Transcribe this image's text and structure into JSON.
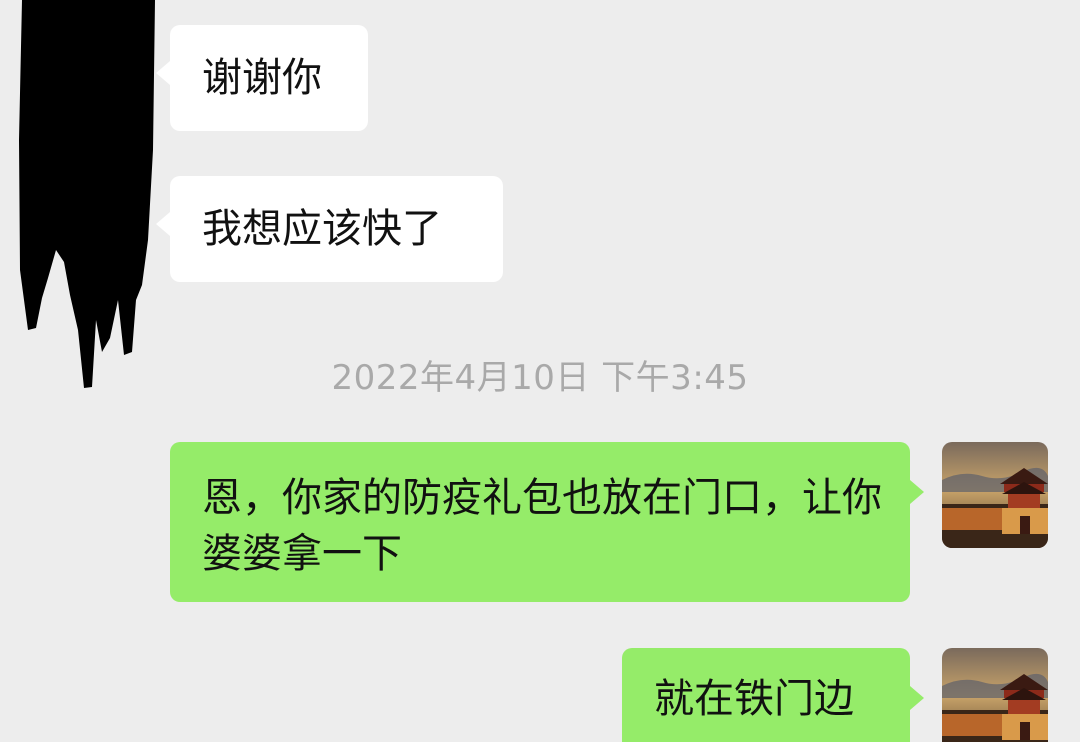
{
  "messages": [
    {
      "side": "left",
      "text": "谢谢你"
    },
    {
      "side": "left",
      "text": "我想应该快了"
    },
    {
      "side": "right",
      "text": "恩，你家的防疫礼包也放在门口，让你婆婆拿一下"
    },
    {
      "side": "right",
      "text": "就在铁门边"
    }
  ],
  "timestamp": "2022年4月10日 下午3:45",
  "colors": {
    "background": "#ededed",
    "incoming_bubble": "#ffffff",
    "outgoing_bubble": "#95ec69",
    "timestamp_text": "#a9a9a9"
  },
  "avatar": {
    "icon": "city-gate-sunset-avatar"
  }
}
